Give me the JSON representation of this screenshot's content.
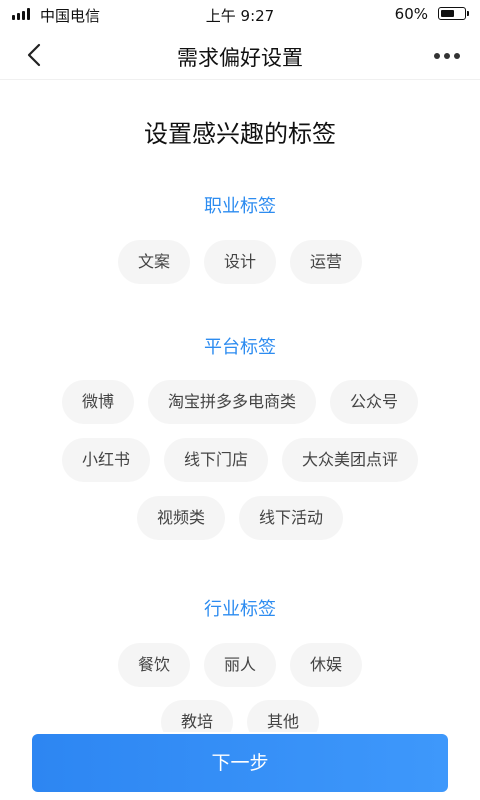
{
  "status_bar": {
    "carrier": "中国电信",
    "time": "上午 9:27",
    "battery_percent": "60%",
    "battery_level": 0.6
  },
  "nav": {
    "title": "需求偏好设置",
    "back_icon": "chevron-left-icon",
    "more_icon": "more-dots-icon"
  },
  "heading": "设置感兴趣的标签",
  "sections": [
    {
      "title": "职业标签",
      "rows": [
        [
          "文案",
          "设计",
          "运营"
        ]
      ]
    },
    {
      "title": "平台标签",
      "rows": [
        [
          "微博",
          "淘宝拼多多电商类",
          "公众号"
        ],
        [
          "小红书",
          "线下门店",
          "大众美团点评"
        ],
        [
          "视频类",
          "线下活动"
        ]
      ]
    },
    {
      "title": "行业标签",
      "rows": [
        [
          "餐饮",
          "丽人",
          "休娱"
        ],
        [
          "教培",
          "其他"
        ]
      ]
    }
  ],
  "next_button": "下一步",
  "colors": {
    "accent": "#2d8cf0",
    "button": "#2d86f2",
    "tag_bg": "#f5f5f5"
  }
}
